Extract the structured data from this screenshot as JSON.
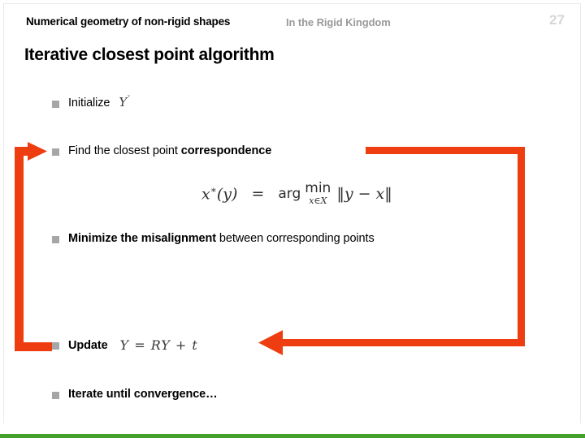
{
  "header": {
    "title": "Numerical geometry of non-rigid shapes",
    "subtitle": "In the Rigid Kingdom",
    "page_number": "27"
  },
  "slide": {
    "title": "Iterative closest point algorithm"
  },
  "bullets": [
    {
      "id": "initialize",
      "label": "Initialize",
      "math": "Y",
      "math_sup": "ˇ",
      "marker": "square-bullet"
    },
    {
      "id": "find",
      "label_normal": "Find the closest point ",
      "label_bold": "correspondence",
      "marker": "square-bullet"
    },
    {
      "id": "minimize",
      "label_bold": "Minimize the misalignment",
      "label_normal": " between corresponding points",
      "marker": "square-bullet"
    },
    {
      "id": "update",
      "label": "Update",
      "math": "Y = RY + t",
      "marker": "square-bullet"
    },
    {
      "id": "iterate",
      "label": "Iterate until convergence…",
      "marker": "square-bullet"
    }
  ],
  "equation": {
    "lhs": "x",
    "lhs_sup": "∗",
    "lhs_arg": "(y)",
    "equals": "=",
    "arg": "arg",
    "min": "min",
    "sub_var": "x",
    "sub_in": "∈",
    "sub_set": "X",
    "norm_open": "‖",
    "norm_body": "y − x",
    "norm_close": "‖"
  },
  "loop": {
    "description": "feedback-loop-arrows",
    "color": "#ee3d11",
    "arrow_to_find": "arrow-right-into-find-bullet",
    "arrow_to_update": "arrow-left-into-update-bullet"
  },
  "colors": {
    "accent_orange": "#ee3d11",
    "bullet_gray": "#a6a6a6",
    "header_gray": "#9a9a9a",
    "page_number_gray": "#d6d6d6",
    "bottom_bar_green": "#46a02c",
    "text_black": "#000000"
  }
}
